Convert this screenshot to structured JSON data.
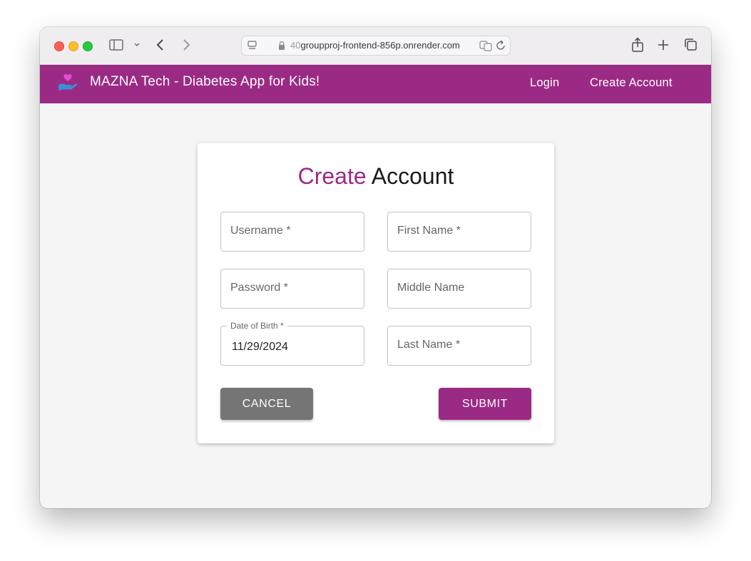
{
  "browser": {
    "url_prefix": "40",
    "url_main": "groupproj-frontend-856p.onrender.com"
  },
  "appbar": {
    "brand": "MAZNA Tech - Diabetes App for Kids!",
    "nav": {
      "login": "Login",
      "create_account": "Create Account"
    }
  },
  "form": {
    "title_accent": "Create",
    "title_rest": " Account",
    "fields": {
      "username": "Username *",
      "first_name": "First Name *",
      "password": "Password *",
      "middle_name": "Middle Name",
      "dob_label": "Date of Birth *",
      "dob_value": "11/29/2024",
      "last_name": "Last Name *"
    },
    "buttons": {
      "cancel": "CANCEL",
      "submit": "SUBMIT"
    }
  },
  "colors": {
    "brand": "#9b2a84",
    "cancel": "#757575",
    "background": "#f5f5f5"
  }
}
